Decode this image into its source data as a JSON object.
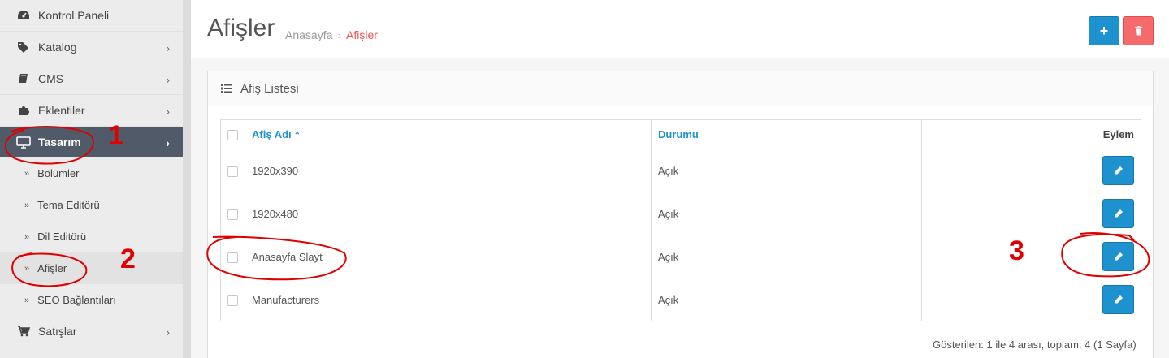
{
  "sidebar": {
    "items": [
      {
        "label": "Kontrol Paneli",
        "icon": "dashboard-icon",
        "has_children": false
      },
      {
        "label": "Katalog",
        "icon": "tags-icon",
        "has_children": true
      },
      {
        "label": "CMS",
        "icon": "book-icon",
        "has_children": true
      },
      {
        "label": "Eklentiler",
        "icon": "puzzle-icon",
        "has_children": true
      },
      {
        "label": "Tasarım",
        "icon": "monitor-icon",
        "has_children": true,
        "active": true
      },
      {
        "label": "Satışlar",
        "icon": "cart-icon",
        "has_children": true
      }
    ],
    "subitems": [
      {
        "label": "Bölümler"
      },
      {
        "label": "Tema Editörü"
      },
      {
        "label": "Dil Editörü"
      },
      {
        "label": "Afişler",
        "current": true
      },
      {
        "label": "SEO Bağlantıları"
      }
    ]
  },
  "header": {
    "title": "Afişler",
    "breadcrumb": [
      {
        "label": "Anasayfa"
      },
      {
        "label": "Afişler",
        "current": true
      }
    ]
  },
  "panel": {
    "title": "Afiş Listesi",
    "columns": {
      "name": "Afiş Adı",
      "status": "Durumu",
      "action": "Eylem"
    },
    "rows": [
      {
        "name": "1920x390",
        "status": "Açık"
      },
      {
        "name": "1920x480",
        "status": "Açık"
      },
      {
        "name": "Anasayfa Slayt",
        "status": "Açık"
      },
      {
        "name": "Manufacturers",
        "status": "Açık"
      }
    ],
    "pagination_text": "Gösterilen: 1 ile 4 arası, toplam: 4 (1 Sayfa)"
  },
  "annotations": {
    "labels": [
      "1",
      "2",
      "3"
    ],
    "color": "#e00000"
  },
  "colors": {
    "primary": "#1e91cf",
    "danger": "#f56b6b",
    "sidebar_active": "#505a68",
    "breadcrumb_current": "#e9534f"
  }
}
